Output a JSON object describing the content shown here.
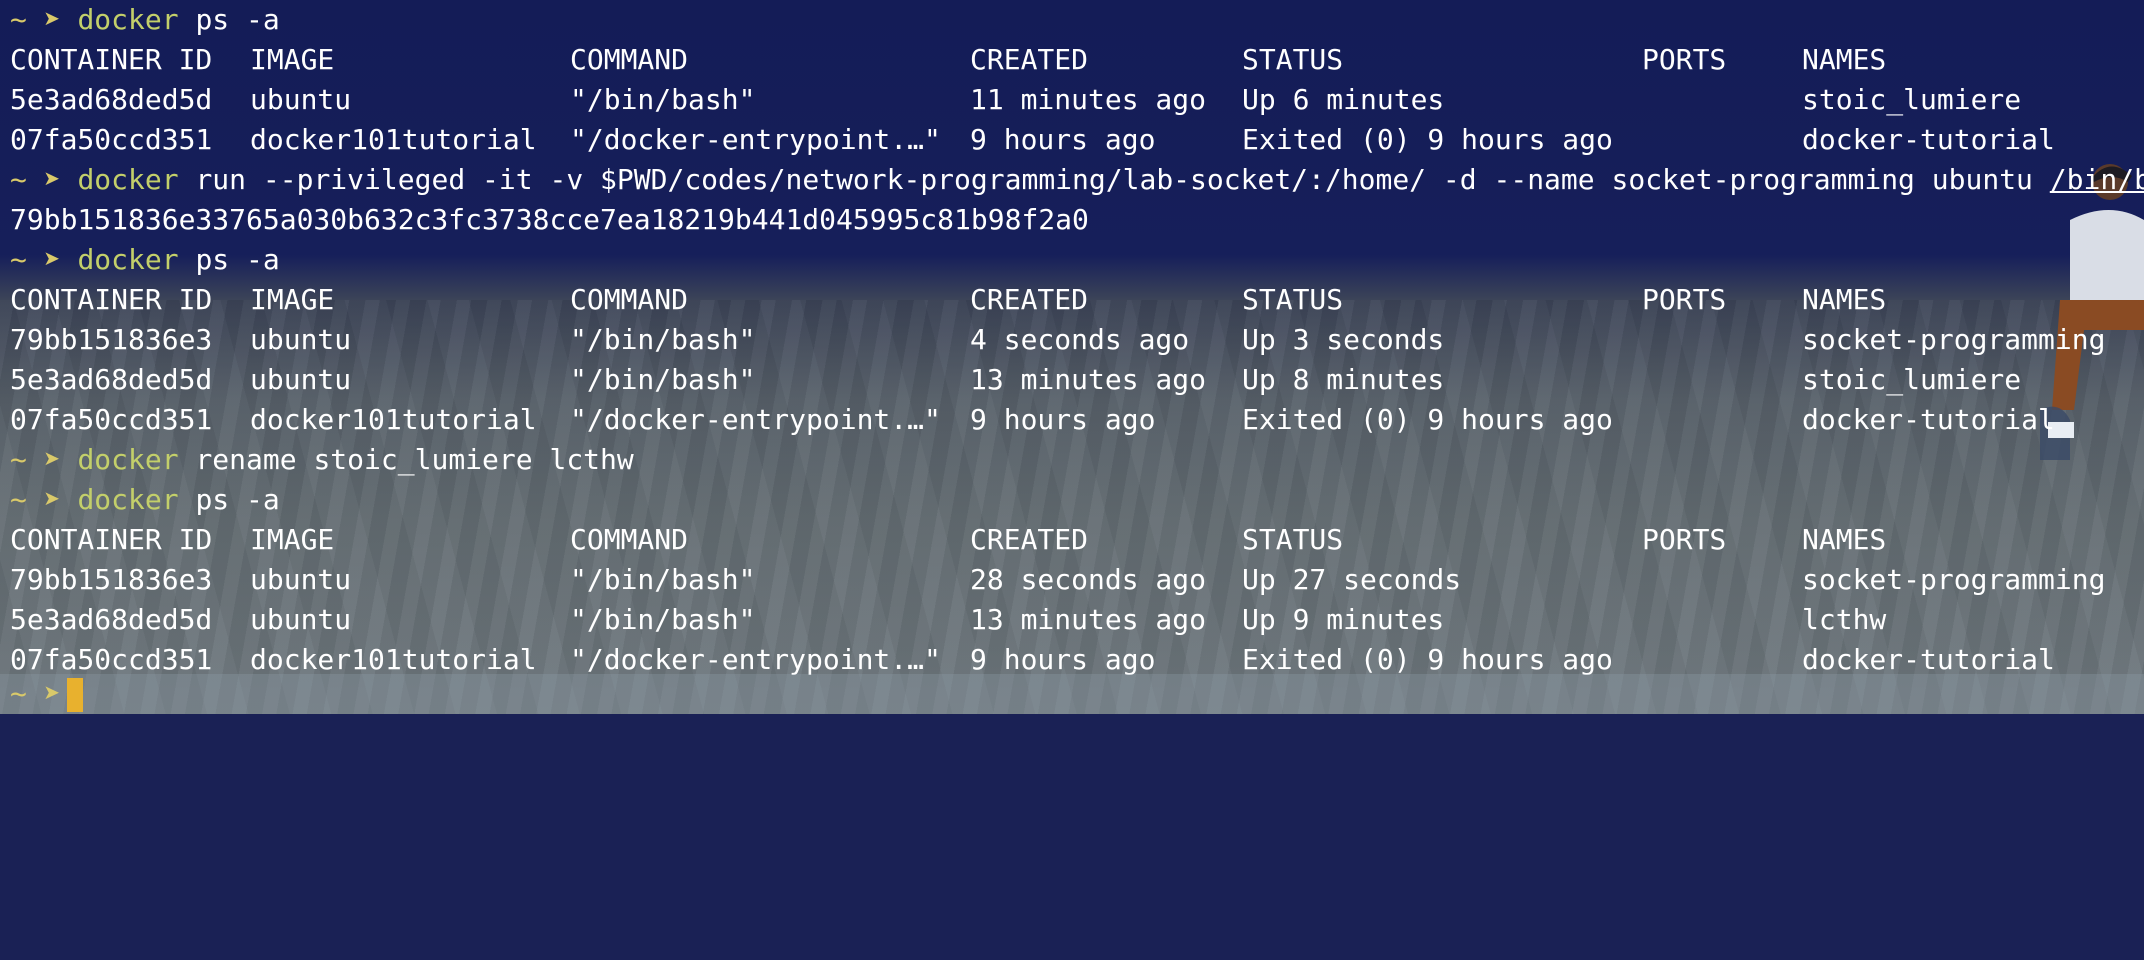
{
  "prompt": {
    "tilde": "~",
    "arrow": "➤"
  },
  "commands": [
    {
      "cmd": "docker",
      "args": " ps -a"
    },
    {
      "cmd": "docker",
      "args": " run --privileged -it -v $PWD/codes/network-programming/lab-socket/:/home/ -d --name socket-programming ubuntu ",
      "underlined": "/bin/bash"
    },
    {
      "cmd": "docker",
      "args": " ps -a"
    },
    {
      "cmd": "docker",
      "args": " rename stoic_lumiere lcthw"
    },
    {
      "cmd": "docker",
      "args": " ps -a"
    }
  ],
  "run_output": "79bb151836e33765a030b632c3fc3738cce7ea18219b441d045995c81b98f2a0",
  "headers": [
    "CONTAINER ID",
    "IMAGE",
    "COMMAND",
    "CREATED",
    "STATUS",
    "PORTS",
    "NAMES"
  ],
  "table1": [
    [
      "5e3ad68ded5d",
      "ubuntu",
      "\"/bin/bash\"",
      "11 minutes ago",
      "Up 6 minutes",
      "",
      "stoic_lumiere"
    ],
    [
      "07fa50ccd351",
      "docker101tutorial",
      "\"/docker-entrypoint.…\"",
      "9 hours ago",
      "Exited (0) 9 hours ago",
      "",
      "docker-tutorial"
    ]
  ],
  "table2": [
    [
      "79bb151836e3",
      "ubuntu",
      "\"/bin/bash\"",
      "4 seconds ago",
      "Up 3 seconds",
      "",
      "socket-programming"
    ],
    [
      "5e3ad68ded5d",
      "ubuntu",
      "\"/bin/bash\"",
      "13 minutes ago",
      "Up 8 minutes",
      "",
      "stoic_lumiere"
    ],
    [
      "07fa50ccd351",
      "docker101tutorial",
      "\"/docker-entrypoint.…\"",
      "9 hours ago",
      "Exited (0) 9 hours ago",
      "",
      "docker-tutorial"
    ]
  ],
  "table3": [
    [
      "79bb151836e3",
      "ubuntu",
      "\"/bin/bash\"",
      "28 seconds ago",
      "Up 27 seconds",
      "",
      "socket-programming"
    ],
    [
      "5e3ad68ded5d",
      "ubuntu",
      "\"/bin/bash\"",
      "13 minutes ago",
      "Up 9 minutes",
      "",
      "lcthw"
    ],
    [
      "07fa50ccd351",
      "docker101tutorial",
      "\"/docker-entrypoint.…\"",
      "9 hours ago",
      "Exited (0) 9 hours ago",
      "",
      "docker-tutorial"
    ]
  ],
  "colors": {
    "prompt": "#d9c96a",
    "command": "#c3cf6a",
    "text": "#ffffff",
    "cursor": "#e8b12e"
  }
}
